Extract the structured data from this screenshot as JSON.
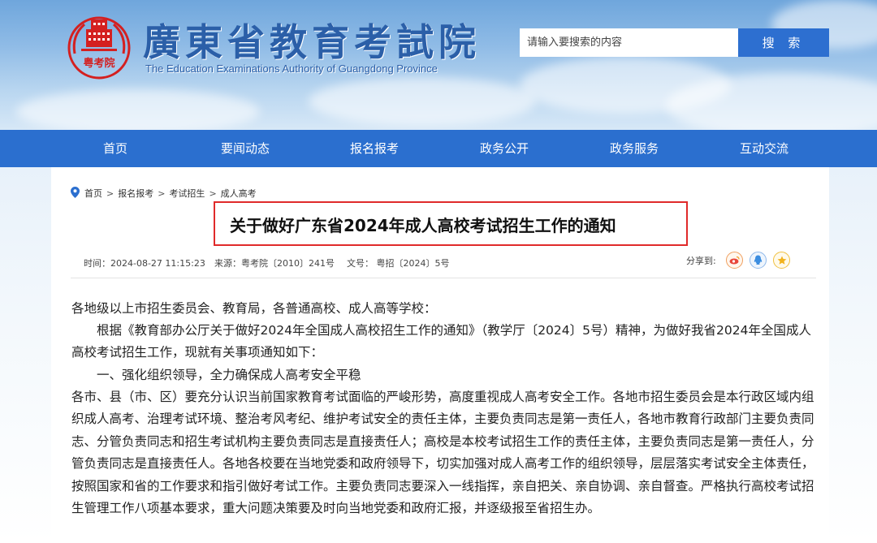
{
  "header": {
    "logo_text": "粤考院",
    "site_title": "廣東省教育考試院",
    "site_subtitle": "The Education Examinations Authority of Guangdong Province",
    "search_placeholder": "请输入要搜索的内容",
    "search_button": "搜 索"
  },
  "nav": {
    "items": [
      "首页",
      "要闻动态",
      "报名报考",
      "政务公开",
      "政务服务",
      "互动交流"
    ]
  },
  "breadcrumb": {
    "items": [
      "首页",
      "报名报考",
      "考试招生",
      "成人高考"
    ],
    "separator": ">"
  },
  "article": {
    "title": "关于做好广东省2024年成人高校考试招生工作的通知",
    "time": "时间：2024-08-27 11:15:23",
    "source": "来源：粤考院〔2010〕241号",
    "doc_no": "文号： 粤招〔2024〕5号",
    "share_label": "分享到:",
    "share_icons": [
      "weibo-icon",
      "qq-zone-icon",
      "favorite-icon"
    ],
    "paragraphs": [
      "各地级以上市招生委员会、教育局，各普通高校、成人高等学校：",
      "　　根据《教育部办公厅关于做好2024年全国成人高校招生工作的通知》（教学厅〔2024〕5号）精神，为做好我省2024年全国成人高校考试招生工作，现就有关事项通知如下：",
      "　　一、强化组织领导，全力确保成人高考安全平稳",
      "各市、县（市、区）要充分认识当前国家教育考试面临的严峻形势，高度重视成人高考安全工作。各地市招生委员会是本行政区域内组织成人高考、治理考试环境、整治考风考纪、维护考试安全的责任主体，主要负责同志是第一责任人，各地市教育行政部门主要负责同志、分管负责同志和招生考试机构主要负责同志是直接责任人；高校是本校考试招生工作的责任主体，主要负责同志是第一责任人，分管负责同志是直接责任人。各地各校要在当地党委和政府领导下，切实加强对成人高考工作的组织领导，层层落实考试安全主体责任，按照国家和省的工作要求和指引做好考试工作。主要负责同志要深入一线指挥，亲自把关、亲自协调、亲自督查。严格执行高校考试招生管理工作八项基本要求，重大问题决策要及时向当地党委和政府汇报，并逐级报至省招生办。"
    ]
  },
  "colors": {
    "brand_blue": "#2b6fcf",
    "title_blue": "#2b5fa8",
    "highlight_red": "#e02a2a"
  }
}
